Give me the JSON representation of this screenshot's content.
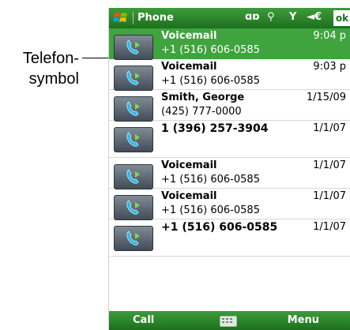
{
  "callout": {
    "line1": "Telefon-",
    "line2": "symbol"
  },
  "titlebar": {
    "title": "Phone",
    "status_glyphs": [
      "ɑɒ",
      "⚲",
      "Y",
      "◄€"
    ],
    "ok_label": "ok"
  },
  "calls": [
    {
      "name": "Voicemail",
      "number": "+1 (516) 606-0585",
      "date": "9:04 p",
      "selected": true
    },
    {
      "name": "Voicemail",
      "number": "+1 (516) 606-0585",
      "date": "9:03 p"
    },
    {
      "name": "Smith, George",
      "number": "(425) 777-0000",
      "date": "1/15/09"
    },
    {
      "name": "1 (396) 257-3904",
      "number": "",
      "date": "1/1/07"
    },
    {
      "name": "Voicemail",
      "number": "+1 (516) 606-0585",
      "date": "1/1/07"
    },
    {
      "name": "Voicemail",
      "number": "+1 (516) 606-0585",
      "date": "1/1/07"
    },
    {
      "name": "+1 (516) 606-0585",
      "number": "",
      "date": "1/1/07"
    }
  ],
  "menubar": {
    "left": "Call",
    "right": "Menu"
  },
  "colors": {
    "titlebar": "#2e8a2c",
    "selection": "#3fa43d"
  }
}
